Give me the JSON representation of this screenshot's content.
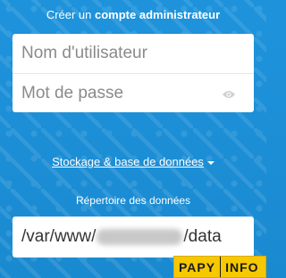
{
  "header": {
    "title_prefix": "Créer un",
    "title_bold": "compte administrateur"
  },
  "form": {
    "username_placeholder": "Nom d'utilisateur",
    "password_placeholder": "Mot de passe",
    "password_toggle_icon": "eye-icon"
  },
  "storage": {
    "link_label": "Stockage & base de données"
  },
  "data_dir": {
    "label": "Répertoire des données",
    "value_start": "/var/www/",
    "value_end": "/data"
  },
  "watermark": {
    "left": "PAPY",
    "right": "INFO"
  },
  "colors": {
    "background": "#1c8fd6",
    "field": "#ffffff",
    "watermark": "#f6c800"
  }
}
